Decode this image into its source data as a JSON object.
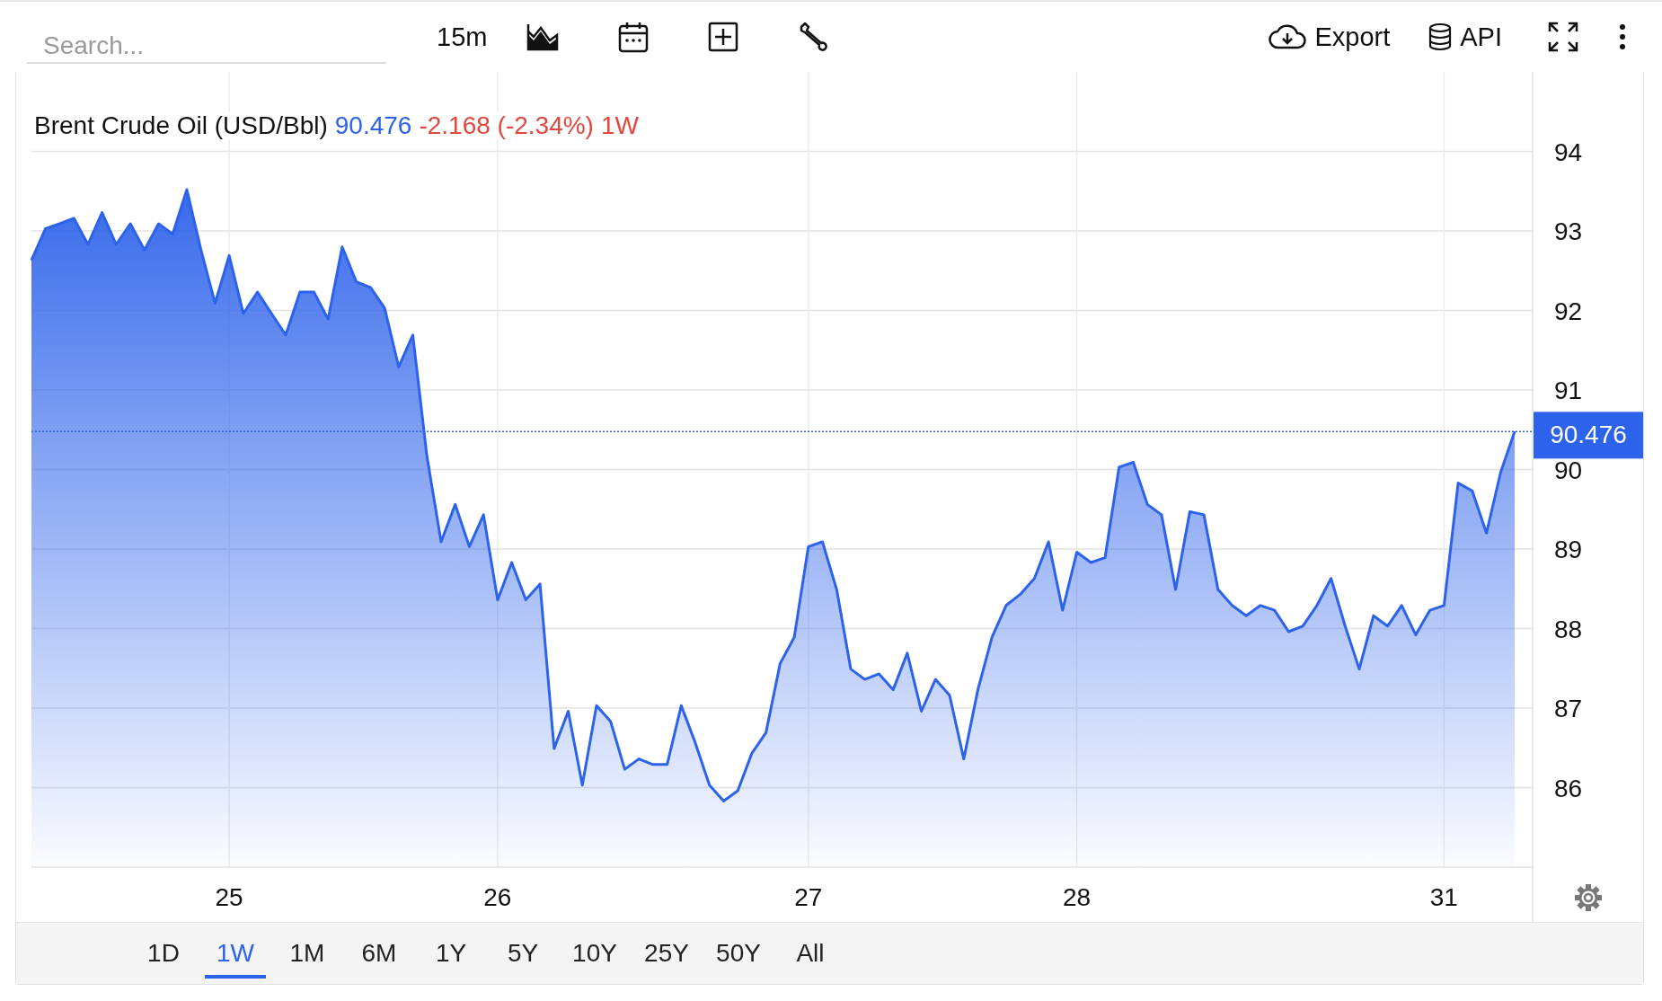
{
  "toolbar": {
    "search": {
      "placeholder": "Search..."
    },
    "interval": "15m",
    "export_label": "Export",
    "api_label": "API"
  },
  "legend": {
    "price": "90.476",
    "change": "-2.168 (-2.34%)",
    "period": "1W"
  },
  "price_tag": "90.476",
  "chart_data": {
    "type": "area",
    "categories": [
      null,
      null,
      null,
      null,
      null,
      null,
      null,
      null,
      null,
      null,
      null,
      null,
      null,
      null,
      "25",
      null,
      null,
      null,
      null,
      null,
      null,
      null,
      null,
      null,
      null,
      null,
      null,
      null,
      null,
      null,
      null,
      null,
      null,
      "26",
      null,
      null,
      null,
      null,
      null,
      null,
      null,
      null,
      null,
      null,
      null,
      null,
      null,
      null,
      null,
      null,
      null,
      null,
      null,
      null,
      null,
      "27",
      null,
      null,
      null,
      null,
      null,
      null,
      null,
      null,
      null,
      null,
      null,
      null,
      null,
      null,
      null,
      null,
      null,
      null,
      "28",
      null,
      null,
      null,
      null,
      null,
      null,
      null,
      null,
      null,
      null,
      null,
      null,
      null,
      null,
      null,
      null,
      null,
      null,
      null,
      null,
      null,
      null,
      null,
      null,
      null,
      "31",
      null,
      null,
      null,
      null,
      null
    ],
    "series": [
      {
        "name": "Brent Crude Oil (USD/Bbl)",
        "color": "#2d62ea",
        "values": [
          92.63,
          93.03,
          93.09,
          93.16,
          92.83,
          93.23,
          92.83,
          93.09,
          92.76,
          93.09,
          92.96,
          93.52,
          92.76,
          92.09,
          92.69,
          91.96,
          92.23,
          91.96,
          91.69,
          92.23,
          92.23,
          91.89,
          92.8,
          92.36,
          92.29,
          92.03,
          91.29,
          91.69,
          90.16,
          89.09,
          89.56,
          89.03,
          89.43,
          88.36,
          88.83,
          88.36,
          88.56,
          86.49,
          86.96,
          86.03,
          87.03,
          86.83,
          86.23,
          86.36,
          86.29,
          86.29,
          87.03,
          86.56,
          86.03,
          85.83,
          85.96,
          86.43,
          86.69,
          87.56,
          87.89,
          89.03,
          89.09,
          88.49,
          87.49,
          87.36,
          87.43,
          87.23,
          87.69,
          86.96,
          87.36,
          87.16,
          86.36,
          87.23,
          87.89,
          88.29,
          88.43,
          88.63,
          89.09,
          88.23,
          88.96,
          88.83,
          88.89,
          90.03,
          90.09,
          89.56,
          89.43,
          88.49,
          89.47,
          89.43,
          88.49,
          88.29,
          88.16,
          88.29,
          88.23,
          87.96,
          88.03,
          88.29,
          88.63,
          88.03,
          87.49,
          88.16,
          88.03,
          88.29,
          87.92,
          88.23,
          88.29,
          89.83,
          89.73,
          89.2,
          89.96,
          90.48
        ]
      }
    ],
    "ylim": [
      85,
      95
    ],
    "grid": true,
    "ref_lines": [
      {
        "axis": "y",
        "value": 90.476
      }
    ],
    "yticks": [
      86,
      87,
      88,
      89,
      90,
      91,
      92,
      93,
      94
    ]
  },
  "ranges": [
    {
      "label": "1D",
      "selected": false
    },
    {
      "label": "1W",
      "selected": true
    },
    {
      "label": "1M",
      "selected": false
    },
    {
      "label": "6M",
      "selected": false
    },
    {
      "label": "1Y",
      "selected": false
    },
    {
      "label": "5Y",
      "selected": false
    },
    {
      "label": "10Y",
      "selected": false
    },
    {
      "label": "25Y",
      "selected": false
    },
    {
      "label": "50Y",
      "selected": false
    },
    {
      "label": "All",
      "selected": false
    }
  ]
}
